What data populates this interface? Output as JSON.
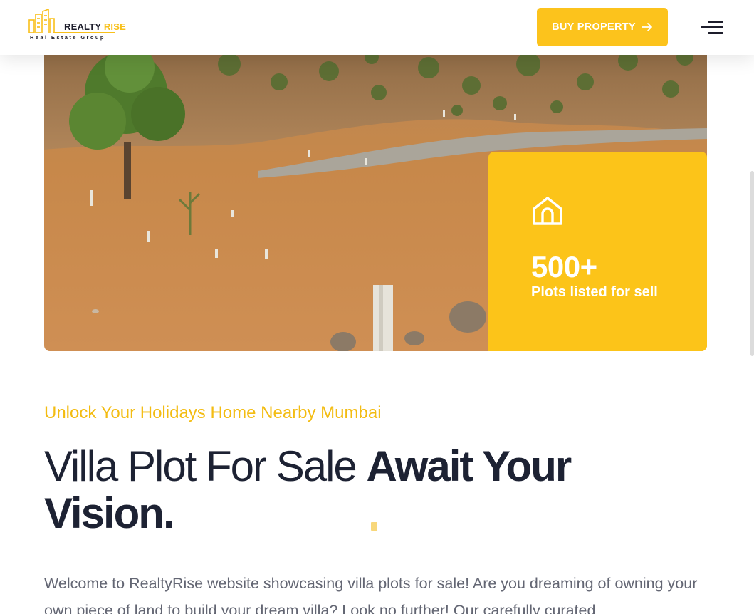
{
  "brand": {
    "name_part1": "REALTY",
    "name_part2": "RISE",
    "tagline": "Real Estate Group",
    "accent": "#fcc31c",
    "dark": "#1d2233"
  },
  "header": {
    "cta_label": "BUY PROPERTY",
    "cta_icon": "arrow-right-icon",
    "menu_icon": "hamburger-menu-icon"
  },
  "stat": {
    "icon": "house-icon",
    "number": "500+",
    "label": "Plots listed for sell"
  },
  "section": {
    "eyebrow": "Unlock Your Holidays Home Nearby Mumbai",
    "title_light": "Villa Plot For Sale ",
    "title_bold": "Await Your Vision",
    "title_end": ".",
    "paragraph": "Welcome to RealtyRise website showcasing villa plots for sale! Are you dreaming of owning your own piece of land to build your dream villa? Look no further! Our carefully curated"
  }
}
